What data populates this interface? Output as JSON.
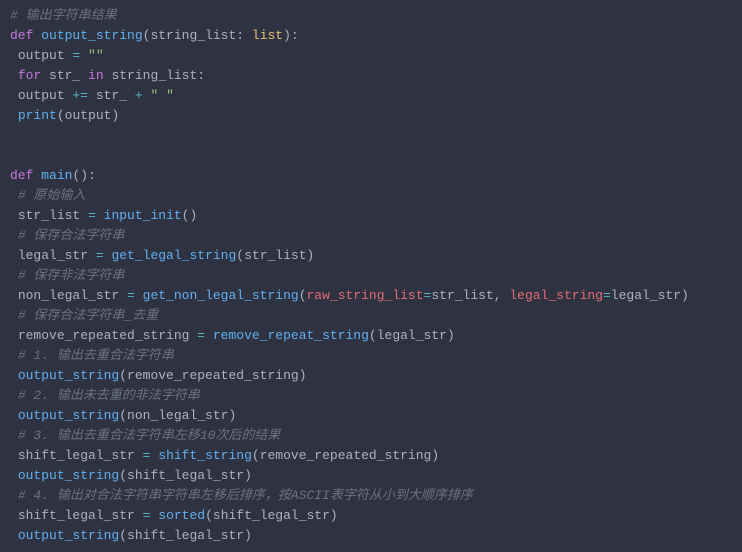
{
  "lines": [
    {
      "indent": 0,
      "tokens": [
        {
          "cls": "cmt",
          "t": "# 输出字符串结果"
        }
      ]
    },
    {
      "indent": 0,
      "tokens": [
        {
          "cls": "kw",
          "t": "def "
        },
        {
          "cls": "fn",
          "t": "output_string"
        },
        {
          "cls": "pun",
          "t": "("
        },
        {
          "cls": "prm",
          "t": "string_list"
        },
        {
          "cls": "pun",
          "t": ": "
        },
        {
          "cls": "typ",
          "t": "list"
        },
        {
          "cls": "pun",
          "t": "):"
        }
      ]
    },
    {
      "indent": 1,
      "tokens": [
        {
          "cls": "txt",
          "t": "output "
        },
        {
          "cls": "op",
          "t": "="
        },
        {
          "cls": "txt",
          "t": " "
        },
        {
          "cls": "str",
          "t": "\"\""
        }
      ]
    },
    {
      "indent": 1,
      "tokens": [
        {
          "cls": "kw",
          "t": "for "
        },
        {
          "cls": "txt",
          "t": "str_ "
        },
        {
          "cls": "kw",
          "t": "in "
        },
        {
          "cls": "txt",
          "t": "string_list:"
        }
      ]
    },
    {
      "indent": 1,
      "tokens": [
        {
          "cls": "txt",
          "t": "output "
        },
        {
          "cls": "op",
          "t": "+="
        },
        {
          "cls": "txt",
          "t": " str_ "
        },
        {
          "cls": "op",
          "t": "+"
        },
        {
          "cls": "txt",
          "t": " "
        },
        {
          "cls": "str",
          "t": "\" \""
        }
      ]
    },
    {
      "indent": 1,
      "tokens": [
        {
          "cls": "fn",
          "t": "print"
        },
        {
          "cls": "pun",
          "t": "("
        },
        {
          "cls": "txt",
          "t": "output"
        },
        {
          "cls": "pun",
          "t": ")"
        }
      ]
    },
    {
      "indent": 0,
      "tokens": []
    },
    {
      "indent": 0,
      "tokens": []
    },
    {
      "indent": 0,
      "tokens": [
        {
          "cls": "kw",
          "t": "def "
        },
        {
          "cls": "fn",
          "t": "main"
        },
        {
          "cls": "pun",
          "t": "():"
        }
      ]
    },
    {
      "indent": 1,
      "tokens": [
        {
          "cls": "cmt",
          "t": "# 原始输入"
        }
      ]
    },
    {
      "indent": 1,
      "tokens": [
        {
          "cls": "txt",
          "t": "str_list "
        },
        {
          "cls": "op",
          "t": "="
        },
        {
          "cls": "txt",
          "t": " "
        },
        {
          "cls": "fn",
          "t": "input_init"
        },
        {
          "cls": "pun",
          "t": "()"
        }
      ]
    },
    {
      "indent": 1,
      "tokens": [
        {
          "cls": "cmt",
          "t": "# 保存合法字符串"
        }
      ]
    },
    {
      "indent": 1,
      "tokens": [
        {
          "cls": "txt",
          "t": "legal_str "
        },
        {
          "cls": "op",
          "t": "="
        },
        {
          "cls": "txt",
          "t": " "
        },
        {
          "cls": "fn",
          "t": "get_legal_string"
        },
        {
          "cls": "pun",
          "t": "("
        },
        {
          "cls": "txt",
          "t": "str_list"
        },
        {
          "cls": "pun",
          "t": ")"
        }
      ]
    },
    {
      "indent": 1,
      "tokens": [
        {
          "cls": "cmt",
          "t": "# 保存非法字符串"
        }
      ]
    },
    {
      "indent": 1,
      "tokens": [
        {
          "cls": "txt",
          "t": "non_legal_str "
        },
        {
          "cls": "op",
          "t": "="
        },
        {
          "cls": "txt",
          "t": " "
        },
        {
          "cls": "fn",
          "t": "get_non_legal_string"
        },
        {
          "cls": "pun",
          "t": "("
        },
        {
          "cls": "id",
          "t": "raw_string_list"
        },
        {
          "cls": "op",
          "t": "="
        },
        {
          "cls": "txt",
          "t": "str_list, "
        },
        {
          "cls": "id",
          "t": "legal_string"
        },
        {
          "cls": "op",
          "t": "="
        },
        {
          "cls": "txt",
          "t": "legal_str"
        },
        {
          "cls": "pun",
          "t": ")"
        }
      ]
    },
    {
      "indent": 1,
      "tokens": [
        {
          "cls": "cmt",
          "t": "# 保存合法字符串_去重"
        }
      ]
    },
    {
      "indent": 1,
      "tokens": [
        {
          "cls": "txt",
          "t": "remove_repeated_string "
        },
        {
          "cls": "op",
          "t": "="
        },
        {
          "cls": "txt",
          "t": " "
        },
        {
          "cls": "fn",
          "t": "remove_repeat_string"
        },
        {
          "cls": "pun",
          "t": "("
        },
        {
          "cls": "txt",
          "t": "legal_str"
        },
        {
          "cls": "pun",
          "t": ")"
        }
      ]
    },
    {
      "indent": 1,
      "tokens": [
        {
          "cls": "cmt",
          "t": "# 1. 输出去重合法字符串"
        }
      ]
    },
    {
      "indent": 1,
      "tokens": [
        {
          "cls": "fn",
          "t": "output_string"
        },
        {
          "cls": "pun",
          "t": "("
        },
        {
          "cls": "txt",
          "t": "remove_repeated_string"
        },
        {
          "cls": "pun",
          "t": ")"
        }
      ]
    },
    {
      "indent": 1,
      "tokens": [
        {
          "cls": "cmt",
          "t": "# 2. 输出未去重的非法字符串"
        }
      ]
    },
    {
      "indent": 1,
      "tokens": [
        {
          "cls": "fn",
          "t": "output_string"
        },
        {
          "cls": "pun",
          "t": "("
        },
        {
          "cls": "txt",
          "t": "non_legal_str"
        },
        {
          "cls": "pun",
          "t": ")"
        }
      ]
    },
    {
      "indent": 1,
      "tokens": [
        {
          "cls": "cmt",
          "t": "# 3. 输出去重合法字符串左移10次后的结果"
        }
      ]
    },
    {
      "indent": 1,
      "tokens": [
        {
          "cls": "txt",
          "t": "shift_legal_str "
        },
        {
          "cls": "op",
          "t": "="
        },
        {
          "cls": "txt",
          "t": " "
        },
        {
          "cls": "fn",
          "t": "shift_string"
        },
        {
          "cls": "pun",
          "t": "("
        },
        {
          "cls": "txt",
          "t": "remove_repeated_string"
        },
        {
          "cls": "pun",
          "t": ")"
        }
      ]
    },
    {
      "indent": 1,
      "tokens": [
        {
          "cls": "fn",
          "t": "output_string"
        },
        {
          "cls": "pun",
          "t": "("
        },
        {
          "cls": "txt",
          "t": "shift_legal_str"
        },
        {
          "cls": "pun",
          "t": ")"
        }
      ]
    },
    {
      "indent": 1,
      "tokens": [
        {
          "cls": "cmt",
          "t": "# 4. 输出对合法字符串字符串左移后排序，按ASCII表字符从小到大顺序排序"
        }
      ]
    },
    {
      "indent": 1,
      "tokens": [
        {
          "cls": "txt",
          "t": "shift_legal_str "
        },
        {
          "cls": "op",
          "t": "="
        },
        {
          "cls": "txt",
          "t": " "
        },
        {
          "cls": "fn",
          "t": "sorted"
        },
        {
          "cls": "pun",
          "t": "("
        },
        {
          "cls": "txt",
          "t": "shift_legal_str"
        },
        {
          "cls": "pun",
          "t": ")"
        }
      ]
    },
    {
      "indent": 1,
      "tokens": [
        {
          "cls": "fn",
          "t": "output_string"
        },
        {
          "cls": "pun",
          "t": "("
        },
        {
          "cls": "txt",
          "t": "shift_legal_str"
        },
        {
          "cls": "pun",
          "t": ")"
        }
      ]
    }
  ]
}
